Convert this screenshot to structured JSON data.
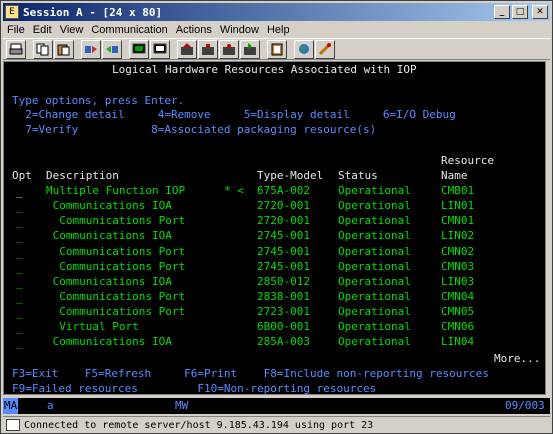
{
  "window": {
    "title": "Session A - [24 x 80]",
    "app_icon": "E"
  },
  "menu": [
    "File",
    "Edit",
    "View",
    "Communication",
    "Actions",
    "Window",
    "Help"
  ],
  "toolbar": [
    "print-icon",
    "copy-icon",
    "paste-icon",
    "send-icon",
    "receive-icon",
    "display-icon",
    "monitor-icon",
    "macro-icon",
    "record-icon",
    "stop-icon",
    "play-icon",
    "clipboard-icon",
    "globe-icon",
    "settings-icon"
  ],
  "screen": {
    "title": "Logical Hardware Resources Associated with IOP",
    "type_options": "Type options, press Enter.",
    "opts_line1": "  2=Change detail     4=Remove     5=Display detail     6=I/O Debug",
    "opts_line2": "  7=Verify           8=Associated packaging resource(s)",
    "col_resource": "Resource",
    "col_opt": "Opt",
    "col_desc": "Description",
    "col_type": "Type-Model",
    "col_status": "Status",
    "col_name": "Name",
    "rows": [
      {
        "desc": "Multiple Function IOP",
        "mark": "* <",
        "type": "675A-002",
        "status": "Operational",
        "name": "CMB01"
      },
      {
        "desc": " Communications IOA",
        "mark": "",
        "type": "2720-001",
        "status": "Operational",
        "name": "LIN01"
      },
      {
        "desc": "  Communications Port",
        "mark": "",
        "type": "2720-001",
        "status": "Operational",
        "name": "CMN01"
      },
      {
        "desc": " Communications IOA",
        "mark": "",
        "type": "2745-001",
        "status": "Operational",
        "name": "LIN02"
      },
      {
        "desc": "  Communications Port",
        "mark": "",
        "type": "2745-001",
        "status": "Operational",
        "name": "CMN02"
      },
      {
        "desc": "  Communications Port",
        "mark": "",
        "type": "2745-001",
        "status": "Operational",
        "name": "CMN03"
      },
      {
        "desc": " Communications IOA",
        "mark": "",
        "type": "2850-012",
        "status": "Operational",
        "name": "LIN03"
      },
      {
        "desc": "  Communications Port",
        "mark": "",
        "type": "2838-001",
        "status": "Operational",
        "name": "CMN04"
      },
      {
        "desc": "  Communications Port",
        "mark": "",
        "type": "2723-001",
        "status": "Operational",
        "name": "CMN05"
      },
      {
        "desc": "  Virtual Port",
        "mark": "",
        "type": "6B00-001",
        "status": "Operational",
        "name": "CMN06"
      },
      {
        "desc": " Communications IOA",
        "mark": "",
        "type": "285A-003",
        "status": "Operational",
        "name": "LIN04"
      }
    ],
    "more": "More...",
    "fkeys1": "F3=Exit    F5=Refresh     F6=Print    F8=Include non-reporting resources",
    "fkeys2": "F9=Failed resources         F10=Non-reporting resources"
  },
  "oia": {
    "ma": "MA",
    "a": "a",
    "mw": "MW",
    "pos": "09/003"
  },
  "status": {
    "text": "Connected to remote server/host 9.185.43.194 using port 23"
  }
}
